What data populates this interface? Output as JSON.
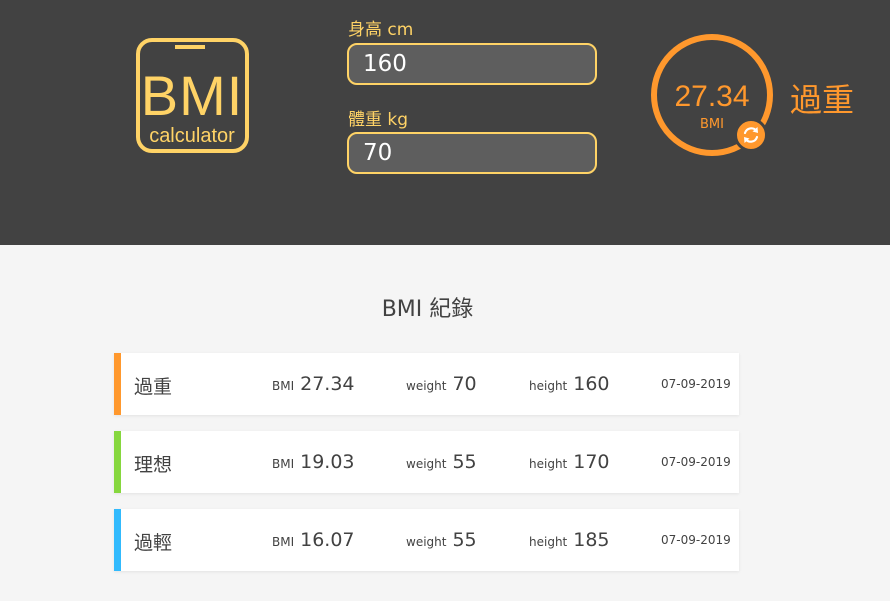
{
  "app": {
    "logo": {
      "text": "BMI",
      "subtitle": "calculator"
    }
  },
  "form": {
    "height_label": "身高 cm",
    "height_value": "160",
    "weight_label": "體重 kg",
    "weight_value": "70"
  },
  "result": {
    "value": "27.34",
    "unit": "BMI",
    "status": "過重",
    "color": "#ff982d",
    "refresh_icon": "refresh-icon"
  },
  "records": {
    "title": "BMI 紀錄",
    "bmi_label": "BMI",
    "weight_label": "weight",
    "height_label": "height",
    "items": [
      {
        "status": "過重",
        "bmi": "27.34",
        "weight": "70",
        "height": "160",
        "date": "07-09-2019",
        "color": "#ff982d"
      },
      {
        "status": "理想",
        "bmi": "19.03",
        "weight": "55",
        "height": "170",
        "date": "07-09-2019",
        "color": "#86d73e"
      },
      {
        "status": "過輕",
        "bmi": "16.07",
        "weight": "55",
        "height": "185",
        "date": "07-09-2019",
        "color": "#31bafd"
      }
    ]
  },
  "colors": {
    "header_bg": "#424242",
    "accent_yellow": "#ffd366",
    "page_bg": "#f5f5f5"
  }
}
